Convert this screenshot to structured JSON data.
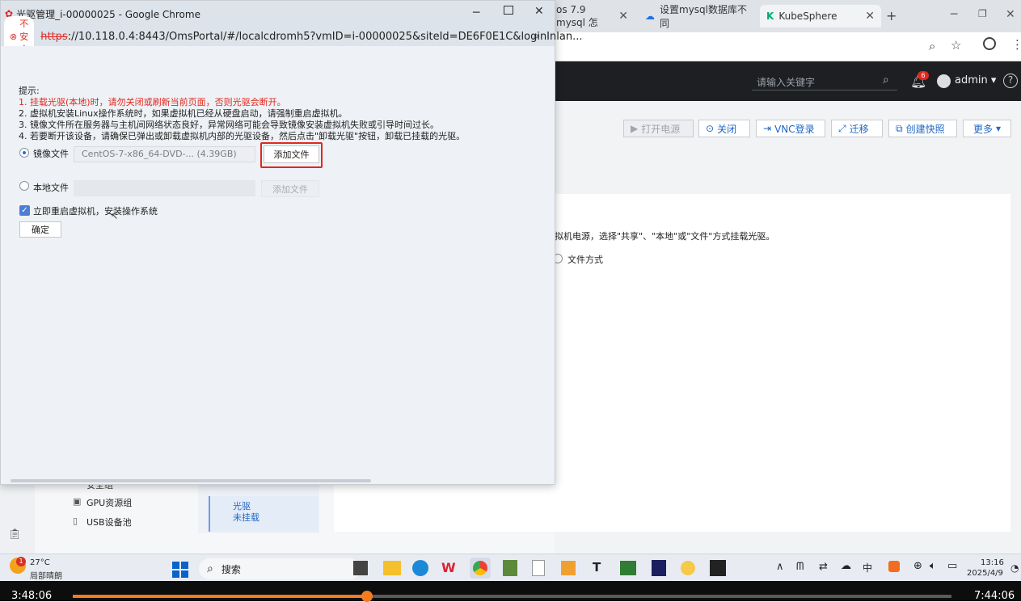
{
  "background_browser": {
    "tabs": [
      {
        "label": "os 7.9 mysql 怎"
      },
      {
        "label": "设置mysql数据库不同"
      },
      {
        "label": "KubeSphere"
      }
    ],
    "search_placeholder": "请输入关键字",
    "notification_count": "6",
    "user": "admin",
    "toolbar": [
      "打开电源",
      "关闭",
      "VNC登录",
      "迁移",
      "创建快照",
      "更多"
    ],
    "panel_text": "拟机电源，选择\"共享\"、\"本地\"或\"文件\"方式挂载光驱。",
    "radio_label": "文件方式",
    "sidebar_items": [
      "GPU资源组",
      "USB设备池"
    ],
    "sidebar_partial": "安全组",
    "cdrom_label": "光驱",
    "cdrom_status": "未挂载"
  },
  "popup": {
    "title": "光驱管理_i-00000025 - Google Chrome",
    "insecure": "不安全",
    "url_scheme": "https",
    "url_rest": "://10.118.0.4:8443/OmsPortal/#/localcdromh5?vmID=i-00000025&siteId=DE6F0E1C&loginInlan...",
    "tip_title": "提示:",
    "tips": [
      "1. 挂载光驱(本地)时，请勿关闭或刷新当前页面，否则光驱会断开。",
      "2. 虚拟机安装Linux操作系统时，如果虚拟机已经从硬盘启动，请强制重启虚拟机。",
      "3. 镜像文件所在服务器与主机间网络状态良好，异常网络可能会导致镜像安装虚拟机失败或引导时间过长。",
      "4. 若要断开该设备，请确保已弹出或卸载虚拟机内部的光驱设备，然后点击\"卸载光驱\"按钮，卸载已挂载的光驱。"
    ],
    "image_label": "镜像文件",
    "image_value": "CentOS-7-x86_64-DVD-... (4.39GB)",
    "add_file": "添加文件",
    "local_label": "本地文件",
    "add_file_disabled": "添加文件",
    "restart_label": "立即重启虚拟机，安装操作系统",
    "confirm": "确定"
  },
  "taskbar": {
    "badge": "1",
    "temp": "27°C",
    "weather": "局部晴朗",
    "search": "搜索",
    "time": "13:16",
    "date": "2025/4/9"
  },
  "player": {
    "current": "3:48:06",
    "total": "7:44:06",
    "progress": 0.335
  }
}
